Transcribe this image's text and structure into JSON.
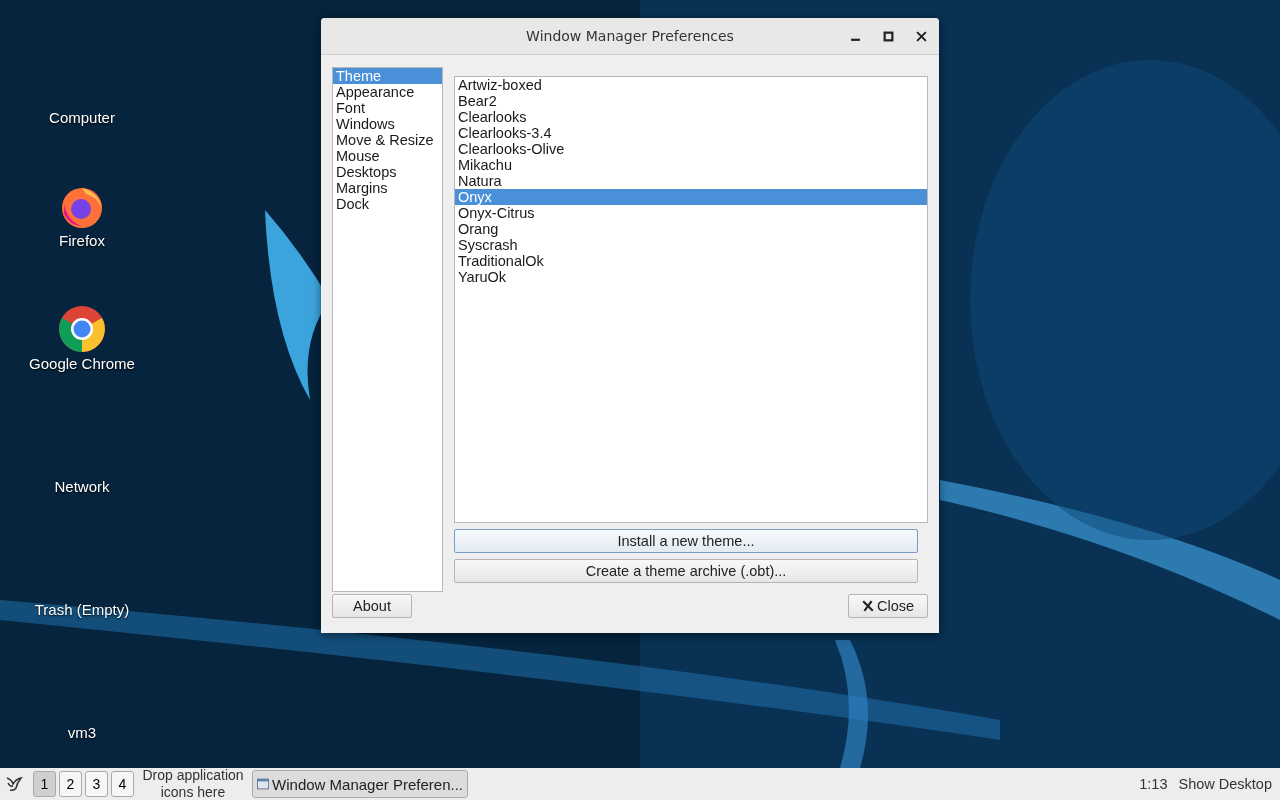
{
  "desktop_icons": [
    {
      "label": "Computer",
      "kind": "plain"
    },
    {
      "label": "Firefox",
      "kind": "firefox"
    },
    {
      "label": "Google Chrome",
      "kind": "chrome"
    },
    {
      "label": "Network",
      "kind": "plain"
    },
    {
      "label": "Trash (Empty)",
      "kind": "plain"
    },
    {
      "label": "vm3",
      "kind": "plain"
    }
  ],
  "window": {
    "title": "Window Manager Preferences",
    "sidebar": {
      "items": [
        {
          "label": "Theme",
          "selected": true
        },
        {
          "label": "Appearance",
          "selected": false
        },
        {
          "label": "Font",
          "selected": false
        },
        {
          "label": "Windows",
          "selected": false
        },
        {
          "label": "Move & Resize",
          "selected": false
        },
        {
          "label": "Mouse",
          "selected": false
        },
        {
          "label": "Desktops",
          "selected": false
        },
        {
          "label": "Margins",
          "selected": false
        },
        {
          "label": "Dock",
          "selected": false
        }
      ]
    },
    "themes": [
      {
        "label": "Artwiz-boxed",
        "selected": false
      },
      {
        "label": "Bear2",
        "selected": false
      },
      {
        "label": "Clearlooks",
        "selected": false
      },
      {
        "label": "Clearlooks-3.4",
        "selected": false
      },
      {
        "label": "Clearlooks-Olive",
        "selected": false
      },
      {
        "label": "Mikachu",
        "selected": false
      },
      {
        "label": "Natura",
        "selected": false
      },
      {
        "label": "Onyx",
        "selected": true
      },
      {
        "label": "Onyx-Citrus",
        "selected": false
      },
      {
        "label": "Orang",
        "selected": false
      },
      {
        "label": "Syscrash",
        "selected": false
      },
      {
        "label": "TraditionalOk",
        "selected": false
      },
      {
        "label": "YaruOk",
        "selected": false
      }
    ],
    "install_button": "Install a new theme...",
    "archive_button": "Create a theme archive (.obt)...",
    "about_button": "About",
    "close_button": "Close"
  },
  "taskbar": {
    "desktops": [
      {
        "label": "1",
        "selected": true
      },
      {
        "label": "2",
        "selected": false
      },
      {
        "label": "3",
        "selected": false
      },
      {
        "label": "4",
        "selected": false
      }
    ],
    "launcher_hint": "Drop application icons here",
    "task": "Window Manager Preferen...",
    "clock": "1:13",
    "show_desktop": "Show Desktop"
  }
}
